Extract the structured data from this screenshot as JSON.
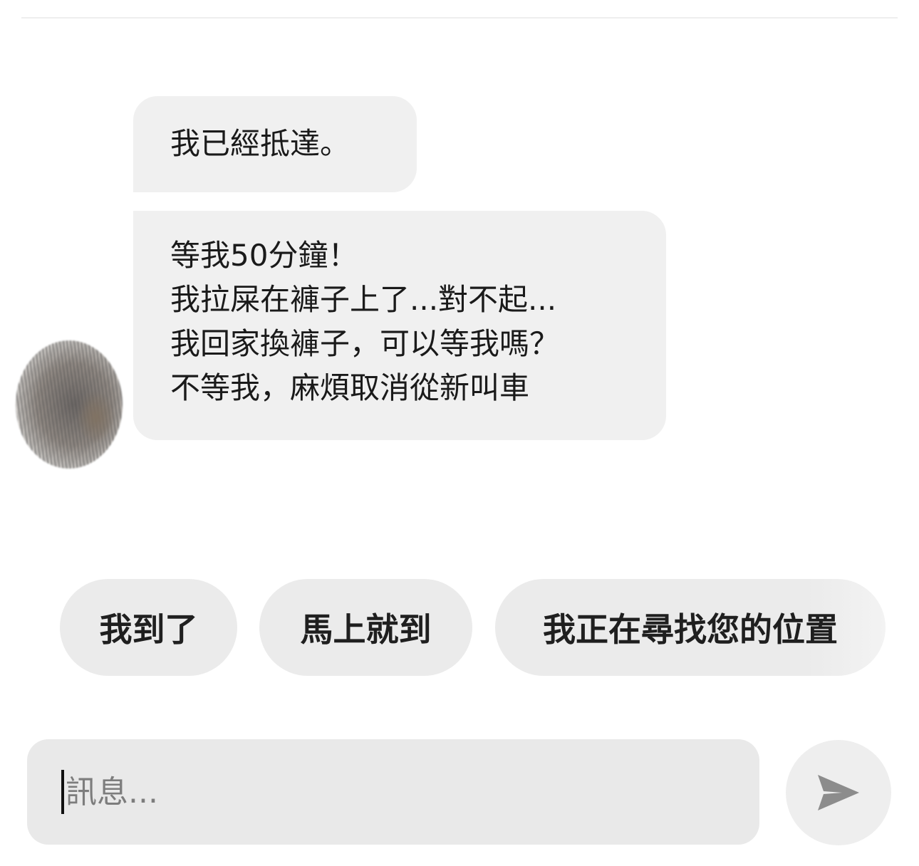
{
  "messages": [
    {
      "sender": "other",
      "lines": [
        "我已經抵達。"
      ]
    },
    {
      "sender": "other",
      "lines": [
        "等我50分鐘！",
        "我拉屎在褲子上了...對不起...",
        "我回家換褲子，可以等我嗎？",
        "不等我，麻煩取消從新叫車"
      ]
    }
  ],
  "quick_replies": [
    "我到了",
    "馬上就到",
    "我正在尋找您的位置"
  ],
  "composer": {
    "placeholder": "訊息...",
    "value": ""
  },
  "icons": {
    "send": "send-icon",
    "avatar": "avatar"
  },
  "colors": {
    "bubble": "#f0f0f0",
    "quick_reply": "#ebebeb",
    "composer": "#e9e9e9",
    "send_button": "#eeeeee",
    "send_icon": "#8c8c8c"
  }
}
